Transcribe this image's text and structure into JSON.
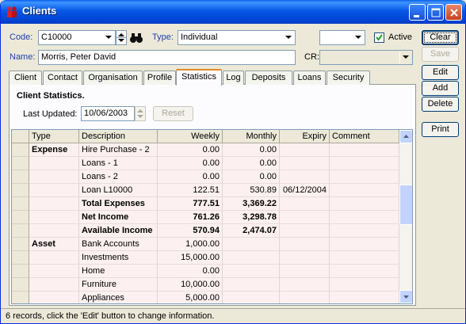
{
  "window": {
    "title": "Clients"
  },
  "form": {
    "code_label": "Code:",
    "code_value": "C10000",
    "type_label": "Type:",
    "type_value": "Individual",
    "active_label": "Active",
    "active_checked": true,
    "name_label": "Name:",
    "name_value": "Morris, Peter David",
    "cr_label": "CR:",
    "cr_value": "",
    "extra_combo_value": ""
  },
  "side_buttons": {
    "clear": "Clear",
    "save": "Save",
    "edit": "Edit",
    "add": "Add",
    "delete": "Delete",
    "print": "Print"
  },
  "tabs": [
    "Client",
    "Contact",
    "Organisation",
    "Profile",
    "Statistics",
    "Log",
    "Deposits",
    "Loans",
    "Security"
  ],
  "active_tab": "Statistics",
  "statistics": {
    "heading": "Client Statistics.",
    "last_updated_label": "Last Updated:",
    "last_updated_value": "10/06/2003",
    "reset_label": "Reset"
  },
  "grid": {
    "columns": [
      "Type",
      "Description",
      "Weekly",
      "Monthly",
      "Expiry",
      "Comment"
    ],
    "rows": [
      {
        "type": "Expense",
        "description": "Hire Purchase - 2",
        "weekly": "0.00",
        "monthly": "0.00",
        "expiry": "",
        "comment": "",
        "bold": false
      },
      {
        "type": "",
        "description": "Loans - 1",
        "weekly": "0.00",
        "monthly": "0.00",
        "expiry": "",
        "comment": "",
        "bold": false
      },
      {
        "type": "",
        "description": "Loans - 2",
        "weekly": "0.00",
        "monthly": "0.00",
        "expiry": "",
        "comment": "",
        "bold": false
      },
      {
        "type": "",
        "description": "Loan L10000",
        "weekly": "122.51",
        "monthly": "530.89",
        "expiry": "06/12/2004",
        "comment": "",
        "bold": false
      },
      {
        "type": "",
        "description": "Total Expenses",
        "weekly": "777.51",
        "monthly": "3,369.22",
        "expiry": "",
        "comment": "",
        "bold": true
      },
      {
        "type": "",
        "description": "Net Income",
        "weekly": "761.26",
        "monthly": "3,298.78",
        "expiry": "",
        "comment": "",
        "bold": true
      },
      {
        "type": "",
        "description": "Available Income",
        "weekly": "570.94",
        "monthly": "2,474.07",
        "expiry": "",
        "comment": "",
        "bold": true
      },
      {
        "type": "Asset",
        "description": "Bank Accounts",
        "weekly": "1,000.00",
        "monthly": "",
        "expiry": "",
        "comment": "",
        "bold": false
      },
      {
        "type": "",
        "description": "Investments",
        "weekly": "15,000.00",
        "monthly": "",
        "expiry": "",
        "comment": "",
        "bold": false
      },
      {
        "type": "",
        "description": "Home",
        "weekly": "0.00",
        "monthly": "",
        "expiry": "",
        "comment": "",
        "bold": false
      },
      {
        "type": "",
        "description": "Furniture",
        "weekly": "10,000.00",
        "monthly": "",
        "expiry": "",
        "comment": "",
        "bold": false
      },
      {
        "type": "",
        "description": "Appliances",
        "weekly": "5,000.00",
        "monthly": "",
        "expiry": "",
        "comment": "",
        "bold": false
      }
    ]
  },
  "status": {
    "text": "6 records, click the 'Edit' button to change information."
  },
  "colors": {
    "title_bar": "#0858e6",
    "label_blue": "#1f3fb3",
    "grid_bg": "#fcf0f0",
    "active_tab_accent": "#e68b2c"
  },
  "icons": {
    "app": "people-icon",
    "find": "binoculars-icon",
    "minimize": "minimize-icon",
    "maximize": "maximize-icon",
    "close": "close-icon"
  }
}
